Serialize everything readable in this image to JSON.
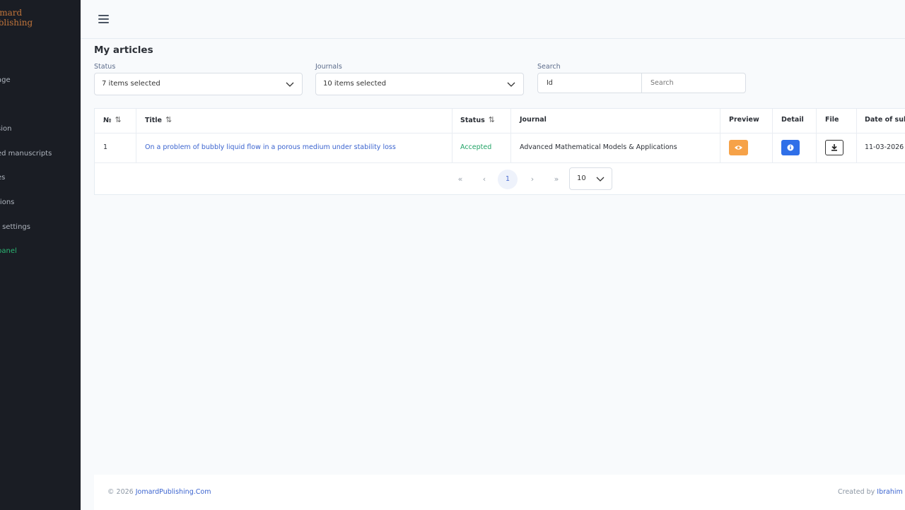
{
  "sidebar": {
    "brand_line1": "omard",
    "brand_line2": "ublishing",
    "items": [
      {
        "label": "age"
      },
      {
        "label": "sion"
      },
      {
        "label": "ed manuscripts"
      },
      {
        "label": "es"
      },
      {
        "label": "tions"
      },
      {
        "label": "t settings"
      },
      {
        "label": "panel"
      }
    ]
  },
  "page": {
    "title": "My articles"
  },
  "filters": {
    "status_label": "Status",
    "status_value": "7 items selected",
    "journals_label": "Journals",
    "journals_value": "10 items selected",
    "search_label": "Search",
    "id_value": "Id",
    "search_placeholder": "Search"
  },
  "table": {
    "columns": [
      "№",
      "Title",
      "Status",
      "Journal",
      "Preview",
      "Detail",
      "File",
      "Date of sub"
    ],
    "rows": [
      {
        "no": "1",
        "title": "On a problem of bubbly liquid flow in a porous medium under stability loss",
        "status": "Accepted",
        "journal": "Advanced Mathematical Models & Applications",
        "date": "11-03-2026"
      }
    ]
  },
  "pagination": {
    "first": "«",
    "prev": "‹",
    "current": "1",
    "next": "›",
    "last": "»",
    "page_size": "10"
  },
  "footer": {
    "copyright_prefix": "© 2026 ",
    "copyright_link": "JomardPublishing.Com",
    "created_prefix": "Created by ",
    "created_link": "Ibrahim"
  },
  "colors": {
    "sidebar_bg": "#1a1d24",
    "accent_blue": "#3a63cf",
    "status_green": "#21a366",
    "preview_orange": "#f6a248",
    "detail_blue": "#2f6fe8"
  }
}
